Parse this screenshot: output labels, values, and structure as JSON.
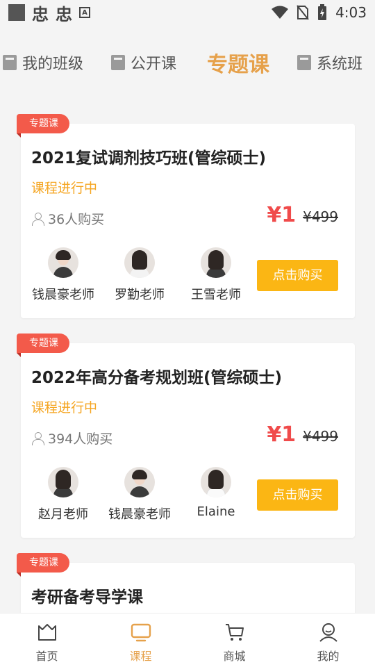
{
  "status_bar": {
    "bug_1": "忠",
    "bug_2": "忠",
    "a_icon": "A",
    "time": "4:03"
  },
  "top_tabs": [
    {
      "label": "我的班级",
      "icon": "book-icon"
    },
    {
      "label": "公开课",
      "icon": "book-icon"
    },
    {
      "label": "专题课",
      "active": true
    },
    {
      "label": "系统班",
      "icon": "book-icon"
    }
  ],
  "courses": [
    {
      "tag": "专题课",
      "title": "2021复试调剂技巧班(管综硕士)",
      "status": "课程进行中",
      "buyers": "36人购买",
      "price_now": "¥1",
      "price_old": "¥499",
      "teachers": [
        {
          "name": "钱晨豪老师"
        },
        {
          "name": "罗勤老师"
        },
        {
          "name": "王雪老师"
        }
      ],
      "button": "点击购买"
    },
    {
      "tag": "专题课",
      "title": "2022年高分备考规划班(管综硕士)",
      "status": "课程进行中",
      "buyers": "394人购买",
      "price_now": "¥1",
      "price_old": "¥499",
      "teachers": [
        {
          "name": "赵月老师"
        },
        {
          "name": "钱晨豪老师"
        },
        {
          "name": "Elaine"
        }
      ],
      "button": "点击购买"
    },
    {
      "tag": "专题课",
      "title": "考研备考导学课"
    }
  ],
  "bottom_nav": [
    {
      "label": "首页",
      "icon": "home-icon"
    },
    {
      "label": "课程",
      "icon": "tv-icon",
      "active": true
    },
    {
      "label": "商城",
      "icon": "cart-icon"
    },
    {
      "label": "我的",
      "icon": "profile-icon"
    }
  ],
  "colors": {
    "accent": "#e6a14b",
    "price_red": "#f04b4b",
    "status_orange": "#f5a623",
    "button_yellow": "#fbb614",
    "tag_red": "#f35a4a"
  }
}
